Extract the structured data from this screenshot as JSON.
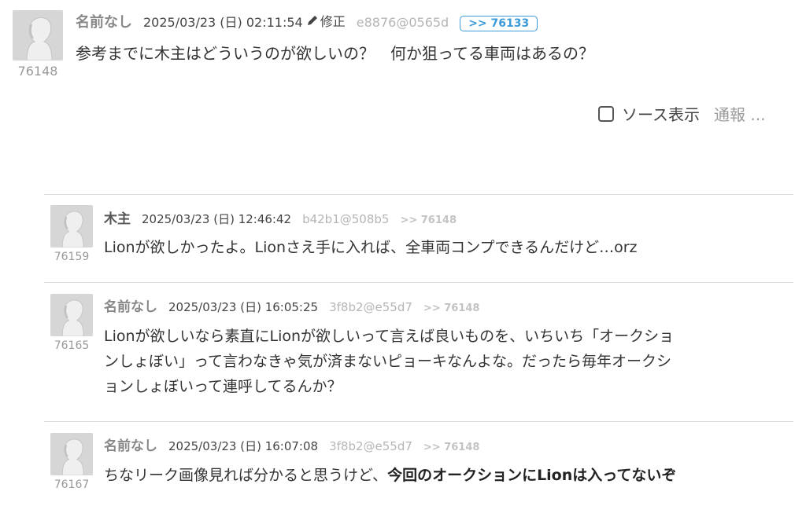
{
  "posts": [
    {
      "number": "76148",
      "name": "名前なし",
      "date": "2025/03/23 (日) 02:11:54",
      "edit_label": "修正",
      "hash": "e8876@0565d",
      "reply_to": ">> 76133",
      "body": "参考までに木主はどういうのが欲しいの？　何か狙ってる車両はあるの？",
      "source_label": "ソース表示",
      "report_label": "通報 ..."
    },
    {
      "number": "76159",
      "name": "木主",
      "date": "2025/03/23 (日) 12:46:42",
      "hash": "b42b1@508b5",
      "reply_to": ">> 76148",
      "body": "Lionが欲しかったよ。Lionさえ手に入れば、全車両コンプできるんだけど…orz"
    },
    {
      "number": "76165",
      "name": "名前なし",
      "date": "2025/03/23 (日) 16:05:25",
      "hash": "3f8b2@e55d7",
      "reply_to": ">> 76148",
      "body_lines": [
        "Lionが欲しいなら素直にLionが欲しいって言えば良いものを、いちいち「オークショ",
        "ンしょぼい」って言わなきゃ気が済まないピョーキなんよな。だったら毎年オークシ",
        "ョンしょぼいって連呼してるんか？"
      ]
    },
    {
      "number": "76167",
      "name": "名前なし",
      "date": "2025/03/23 (日) 16:07:08",
      "hash": "3f8b2@e55d7",
      "reply_to": ">> 76148",
      "body_plain": "ちなリーク画像見れば分かると思うけど、",
      "body_bold": "今回のオークションにLionは入ってないぞ"
    }
  ],
  "colors": {
    "accent": "#3a9bd8",
    "muted": "#999999",
    "text": "#333333",
    "divider": "#dddddd"
  },
  "icons": [
    "avatar-silhouette-icon",
    "pencil-icon",
    "checkbox-icon"
  ]
}
